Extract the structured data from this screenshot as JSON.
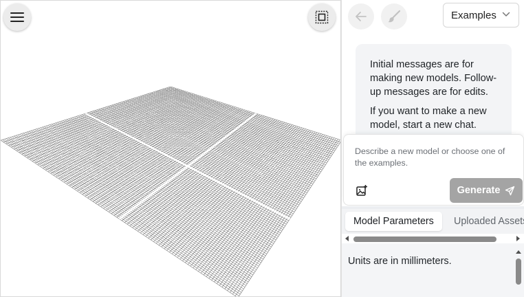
{
  "viewport": {
    "menu_icon": "hamburger-menu-icon",
    "fit_icon": "fit-to-view-icon",
    "grid_color": "#6e6e6e"
  },
  "toolbar": {
    "back_icon": "arrow-left-icon",
    "brush_icon": "paint-brush-icon",
    "examples_label": "Examples"
  },
  "chat": {
    "messages": [
      "Initial messages are for making new models. Follow-up messages are for edits.",
      "If you want to make a new model, start a new chat."
    ]
  },
  "composer": {
    "placeholder": "Describe a new model or choose one of the examples.",
    "attach_icon": "add-image-icon",
    "generate_label": "Generate",
    "generate_icon": "send-icon",
    "generate_color": "#a4a4a4"
  },
  "tabs": [
    {
      "label": "Model Parameters",
      "active": true
    },
    {
      "label": "Uploaded Assets",
      "active": false
    }
  ],
  "parameters": {
    "units_note": "Units are in millimeters."
  }
}
